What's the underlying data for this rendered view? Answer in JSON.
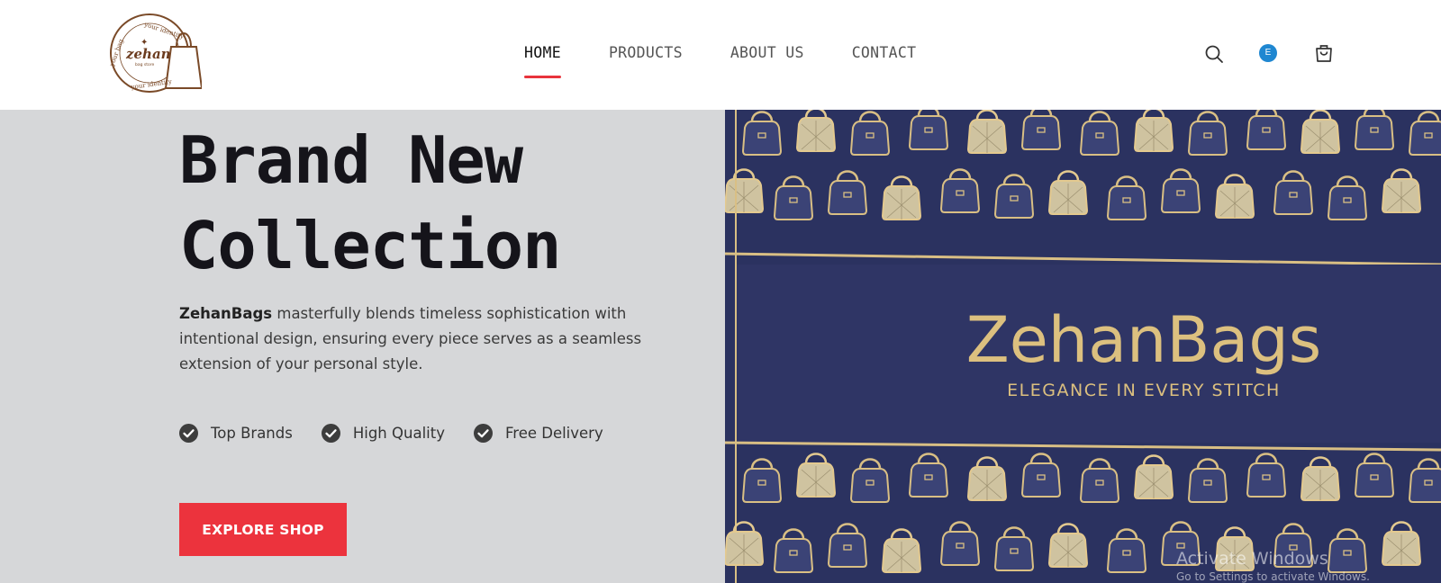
{
  "brand": {
    "logo_script": "zehan",
    "logo_ring_top": "your identity",
    "logo_ring_left": "your bag",
    "logo_ring_bottom": "your identity",
    "logo_tag": "bag store"
  },
  "nav": {
    "items": [
      {
        "label": "HOME",
        "active": true
      },
      {
        "label": "PRODUCTS",
        "active": false
      },
      {
        "label": "ABOUT US",
        "active": false
      },
      {
        "label": "CONTACT",
        "active": false
      }
    ]
  },
  "header_icons": {
    "search": "search-icon",
    "account_initial": "E",
    "cart": "cart-icon"
  },
  "hero": {
    "title_line1": "Brand New",
    "title_line2": "Collection",
    "desc_brand": "ZehanBags",
    "desc_text": " masterfully blends timeless sophistication with intentional design, ensuring every piece serves as a seamless extension of your personal style.",
    "features": [
      "Top Brands",
      "High Quality",
      "Free Delivery"
    ],
    "cta_label": "EXPLORE SHOP"
  },
  "banner": {
    "title": "ZehanBags",
    "tagline": "ELEGANCE IN EVERY STITCH"
  },
  "os_overlay": {
    "title": "Activate Windows",
    "subtitle": "Go to Settings to activate Windows."
  },
  "colors": {
    "accent": "#ec333d",
    "hero_bg": "#d6d7d9",
    "banner_navy": "#2b3260",
    "banner_gold": "#d9bf84",
    "account_badge": "#1f87d1"
  }
}
